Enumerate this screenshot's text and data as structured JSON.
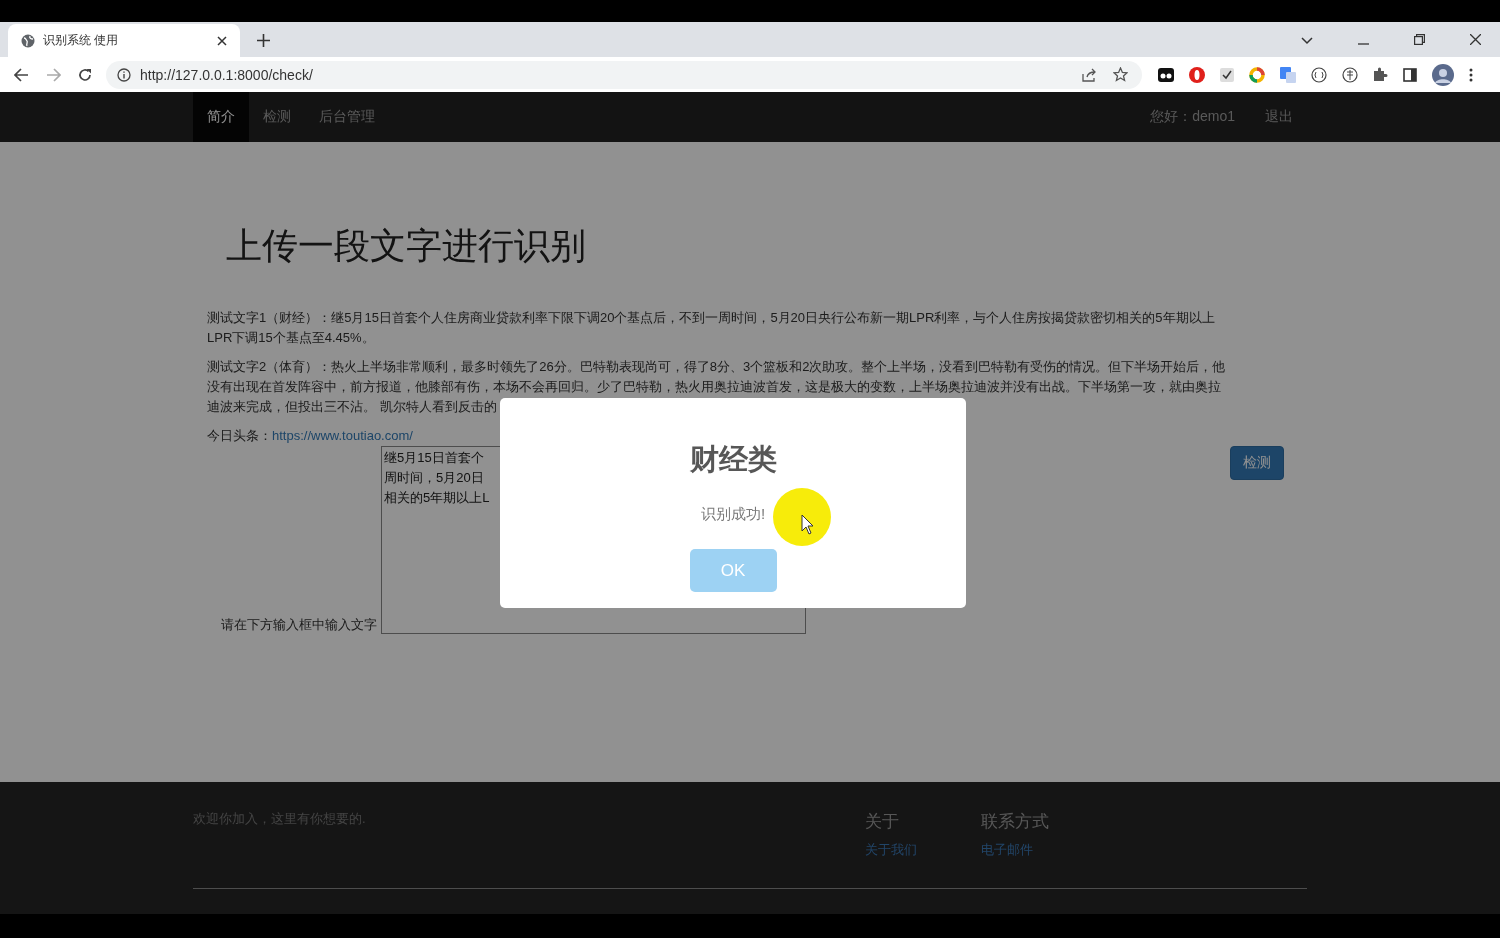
{
  "browser": {
    "tab": {
      "title": "识别系统 使用"
    },
    "url": "http://127.0.0.1:8000/check/"
  },
  "navbar": {
    "items": [
      {
        "label": "简介",
        "selected": true
      },
      {
        "label": "检测",
        "selected": false
      },
      {
        "label": "后台管理",
        "selected": false
      }
    ],
    "greeting": "您好：demo1",
    "logout": "退出"
  },
  "main": {
    "heading": "上传一段文字进行识别",
    "paragraphs": [
      "测试文字1（财经）：继5月15日首套个人住房商业贷款利率下限下调20个基点后，不到一周时间，5月20日央行公布新一期LPR利率，与个人住房按揭贷款密切相关的5年期以上LPR下调15个基点至4.45%。",
      "测试文字2（体育）：热火上半场非常顺利，最多时领先了26分。巴特勒表现尚可，得了8分、3个篮板和2次助攻。整个上半场，没看到巴特勒有受伤的情况。但下半场开始后，他没有出现在首发阵容中，前方报道，他膝部有伤，本场不会再回归。少了巴特勒，热火用奥拉迪波首发，这是极大的变数，上半场奥拉迪波并没有出战。下半场第一攻，就由奥拉迪波来完成，但投出三不沾。 凯尔特人看到反击的"
    ],
    "link_label": "今日头条：",
    "link": "https://www.toutiao.com/",
    "input_label": "请在下方输入框中输入文字",
    "textarea": {
      "value": "继5月15日首套个周时间，5月20日相关的5年期以上L"
    },
    "submit_button": "检测"
  },
  "modal": {
    "title": "财经类",
    "message": "识别成功!",
    "button": "OK"
  },
  "footer": {
    "tagline": "欢迎你加入，这里有你想要的.",
    "columns": [
      {
        "heading": "关于",
        "link": "关于我们"
      },
      {
        "heading": "联系方式",
        "link": "电子邮件"
      }
    ]
  }
}
